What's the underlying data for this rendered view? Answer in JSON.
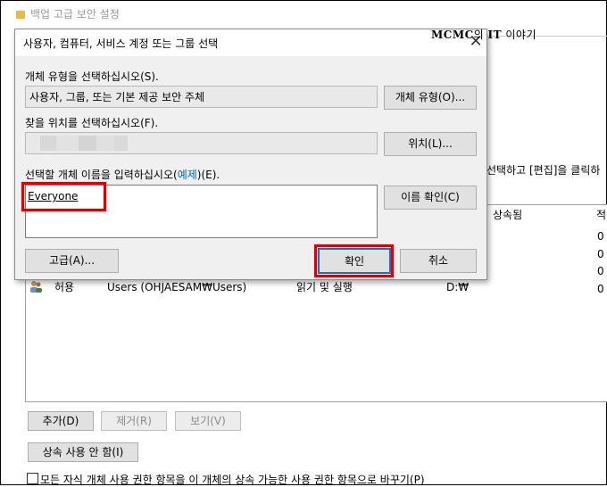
{
  "background_window": {
    "title": "백업 고급 보안 설정",
    "right_text": "선택하고 [편집]을 클릭하",
    "table_headers": {
      "inherited": "상속됨",
      "col_r": "적"
    },
    "row": {
      "type": "허용",
      "principal": "Users (OHJAESAM₩Users)",
      "access": "읽기 및 실행",
      "inherited_from": "D:₩"
    },
    "right_digits": [
      "0",
      "0",
      "0",
      "0"
    ],
    "buttons": {
      "add": "추가(D)",
      "remove": "제거(R)",
      "view": "보기(V)"
    },
    "disable_inheritance": "상속 사용 안 함(I)",
    "replace_checkbox": "모든 자식 개체 사용 권한 항목을 이 개체의 상속 가능한 사용 권한 항목으로 바꾸기(P)"
  },
  "overlay_text": {
    "brand": "MCMC",
    "suffix1": "의 ",
    "brand2": "IT",
    "suffix2": " 이야기"
  },
  "dialog": {
    "title": "사용자, 컴퓨터, 서비스 계정 또는 그룹 선택",
    "object_type_label": "개체 유형을 선택하십시오(S).",
    "object_type_value": "사용자, 그룹, 또는 기본 제공 보안 주체",
    "object_type_button": "개체 유형(O)...",
    "location_label": "찾을 위치를 선택하십시오(F).",
    "location_button": "위치(L)...",
    "enter_label_pre": "선택할 개체 이름을 입력하십시오(",
    "enter_label_link": "예제",
    "enter_label_post": ")(E).",
    "entered_name": "Everyone",
    "check_names_button": "이름 확인(C)",
    "advanced_button": "고급(A)...",
    "ok_button": "확인",
    "cancel_button": "취소",
    "close_glyph": "✕"
  },
  "colors": {
    "highlight": "#e00000",
    "link": "#0066cc"
  }
}
